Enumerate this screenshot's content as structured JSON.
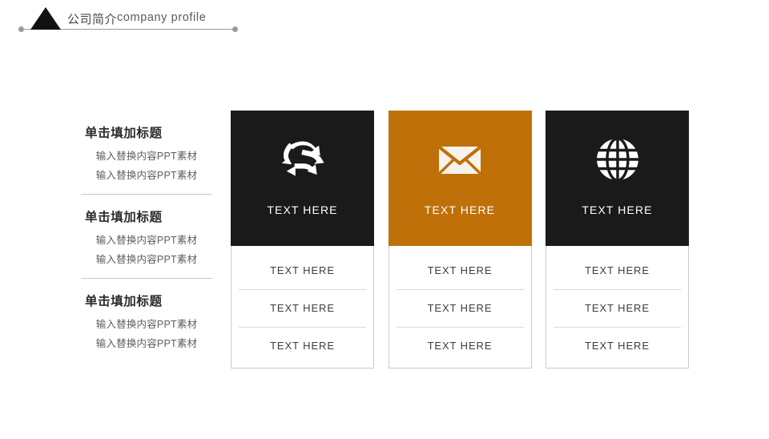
{
  "header": {
    "title_zh": "公司简介",
    "title_en": "company profile",
    "triangle_icon": "triangle-icon",
    "dot_left_icon": "dot-icon",
    "dot_right_icon": "dot-icon",
    "rule_color": "#9a9a9a",
    "triangle_color": "#111111"
  },
  "left_column": {
    "blocks": [
      {
        "title": "单击填加标题",
        "lines": [
          "输入替换内容PPT素材",
          "输入替换内容PPT素材"
        ]
      },
      {
        "title": "单击填加标题",
        "lines": [
          "输入替换内容PPT素材",
          "输入替换内容PPT素材"
        ]
      },
      {
        "title": "单击填加标题",
        "lines": [
          "输入替换内容PPT素材",
          "输入替换内容PPT素材"
        ]
      }
    ]
  },
  "cards": [
    {
      "icon": "recycle-icon",
      "top_label": "TEXT HERE",
      "background": "#1a1a1a",
      "theme": "dark",
      "rows": [
        "TEXT HERE",
        "TEXT HERE",
        "TEXT HERE"
      ]
    },
    {
      "icon": "envelope-icon",
      "top_label": "TEXT HERE",
      "background": "#bf7009",
      "theme": "accent",
      "rows": [
        "TEXT HERE",
        "TEXT HERE",
        "TEXT HERE"
      ]
    },
    {
      "icon": "globe-icon",
      "top_label": "TEXT HERE",
      "background": "#1a1a1a",
      "theme": "dark",
      "rows": [
        "TEXT HERE",
        "TEXT HERE",
        "TEXT HERE"
      ]
    }
  ],
  "colors": {
    "accent": "#bf7009",
    "dark": "#1a1a1a",
    "page_background": "#ffffff",
    "divider": "#c8c8c8",
    "card_border": "#c9c9c9"
  }
}
